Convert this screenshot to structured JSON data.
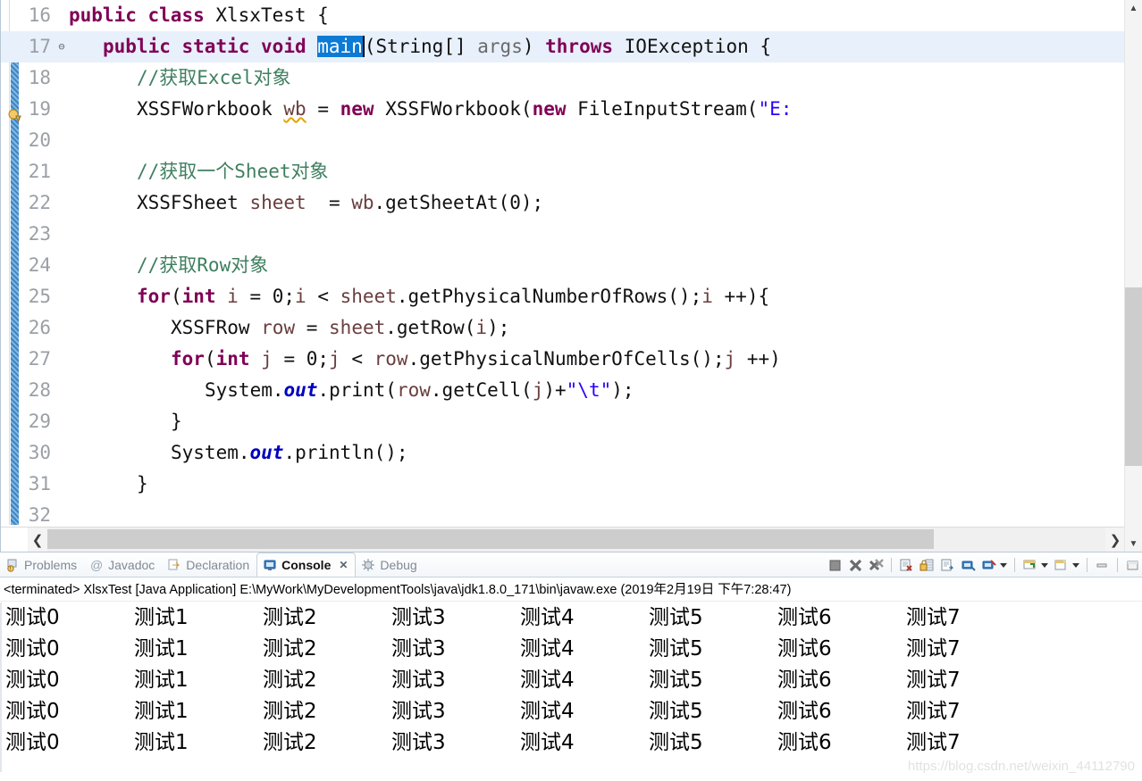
{
  "editor": {
    "first_line": 16,
    "lines": [
      {
        "no": "16",
        "fold": false,
        "warn": false,
        "current": false,
        "indent": 0,
        "tokens": [
          {
            "t": "public ",
            "c": "kw"
          },
          {
            "t": "class ",
            "c": "kw"
          },
          {
            "t": "XlsxTest ",
            "c": "plain"
          },
          {
            "t": "{",
            "c": "plain"
          }
        ]
      },
      {
        "no": "17",
        "fold": true,
        "warn": false,
        "current": true,
        "indent": 1,
        "tokens": [
          {
            "t": "public ",
            "c": "kw"
          },
          {
            "t": "static ",
            "c": "kw"
          },
          {
            "t": "void ",
            "c": "kw"
          },
          {
            "t": "main",
            "c": "sel"
          },
          {
            "t": "(String[] ",
            "c": "plain"
          },
          {
            "t": "args",
            "c": "prm"
          },
          {
            "t": ") ",
            "c": "plain"
          },
          {
            "t": "throws ",
            "c": "kw"
          },
          {
            "t": "IOException {",
            "c": "plain"
          }
        ]
      },
      {
        "no": "18",
        "fold": false,
        "warn": false,
        "current": false,
        "indent": 2,
        "tokens": [
          {
            "t": "//获取Excel对象",
            "c": "cmt"
          }
        ]
      },
      {
        "no": "19",
        "fold": false,
        "warn": true,
        "current": false,
        "indent": 2,
        "tokens": [
          {
            "t": "XSSFWorkbook ",
            "c": "plain"
          },
          {
            "t": "wb",
            "c": "loc warnunder"
          },
          {
            "t": " = ",
            "c": "plain"
          },
          {
            "t": "new ",
            "c": "kw"
          },
          {
            "t": "XSSFWorkbook(",
            "c": "plain"
          },
          {
            "t": "new ",
            "c": "kw"
          },
          {
            "t": "FileInputStream(",
            "c": "plain"
          },
          {
            "t": "\"E:",
            "c": "str"
          }
        ]
      },
      {
        "no": "20",
        "fold": false,
        "warn": false,
        "current": false,
        "indent": 0,
        "tokens": []
      },
      {
        "no": "21",
        "fold": false,
        "warn": false,
        "current": false,
        "indent": 2,
        "tokens": [
          {
            "t": "//获取一个Sheet对象",
            "c": "cmt"
          }
        ]
      },
      {
        "no": "22",
        "fold": false,
        "warn": false,
        "current": false,
        "indent": 2,
        "tokens": [
          {
            "t": "XSSFSheet ",
            "c": "plain"
          },
          {
            "t": "sheet",
            "c": "loc"
          },
          {
            "t": "  = ",
            "c": "plain"
          },
          {
            "t": "wb",
            "c": "loc"
          },
          {
            "t": ".getSheetAt(0);",
            "c": "plain"
          }
        ]
      },
      {
        "no": "23",
        "fold": false,
        "warn": false,
        "current": false,
        "indent": 0,
        "tokens": []
      },
      {
        "no": "24",
        "fold": false,
        "warn": false,
        "current": false,
        "indent": 2,
        "tokens": [
          {
            "t": "//获取Row对象",
            "c": "cmt"
          }
        ]
      },
      {
        "no": "25",
        "fold": false,
        "warn": false,
        "current": false,
        "indent": 2,
        "tokens": [
          {
            "t": "for",
            "c": "kw"
          },
          {
            "t": "(",
            "c": "plain"
          },
          {
            "t": "int ",
            "c": "kw"
          },
          {
            "t": "i",
            "c": "loc"
          },
          {
            "t": " = 0;",
            "c": "plain"
          },
          {
            "t": "i",
            "c": "loc"
          },
          {
            "t": " < ",
            "c": "plain"
          },
          {
            "t": "sheet",
            "c": "loc"
          },
          {
            "t": ".getPhysicalNumberOfRows();",
            "c": "plain"
          },
          {
            "t": "i",
            "c": "loc"
          },
          {
            "t": " ++){",
            "c": "plain"
          }
        ]
      },
      {
        "no": "26",
        "fold": false,
        "warn": false,
        "current": false,
        "indent": 3,
        "tokens": [
          {
            "t": "XSSFRow ",
            "c": "plain"
          },
          {
            "t": "row",
            "c": "loc"
          },
          {
            "t": " = ",
            "c": "plain"
          },
          {
            "t": "sheet",
            "c": "loc"
          },
          {
            "t": ".getRow(",
            "c": "plain"
          },
          {
            "t": "i",
            "c": "loc"
          },
          {
            "t": ");",
            "c": "plain"
          }
        ]
      },
      {
        "no": "27",
        "fold": false,
        "warn": false,
        "current": false,
        "indent": 3,
        "tokens": [
          {
            "t": "for",
            "c": "kw"
          },
          {
            "t": "(",
            "c": "plain"
          },
          {
            "t": "int ",
            "c": "kw"
          },
          {
            "t": "j",
            "c": "loc"
          },
          {
            "t": " = 0;",
            "c": "plain"
          },
          {
            "t": "j",
            "c": "loc"
          },
          {
            "t": " < ",
            "c": "plain"
          },
          {
            "t": "row",
            "c": "loc"
          },
          {
            "t": ".getPhysicalNumberOfCells();",
            "c": "plain"
          },
          {
            "t": "j",
            "c": "loc"
          },
          {
            "t": " ++)",
            "c": "plain"
          }
        ]
      },
      {
        "no": "28",
        "fold": false,
        "warn": false,
        "current": false,
        "indent": 4,
        "tokens": [
          {
            "t": "System.",
            "c": "plain"
          },
          {
            "t": "out",
            "c": "fld"
          },
          {
            "t": ".print(",
            "c": "plain"
          },
          {
            "t": "row",
            "c": "loc"
          },
          {
            "t": ".getCell(",
            "c": "plain"
          },
          {
            "t": "j",
            "c": "loc"
          },
          {
            "t": ")+",
            "c": "plain"
          },
          {
            "t": "\"\\t\"",
            "c": "str"
          },
          {
            "t": ");",
            "c": "plain"
          }
        ]
      },
      {
        "no": "29",
        "fold": false,
        "warn": false,
        "current": false,
        "indent": 3,
        "tokens": [
          {
            "t": "}",
            "c": "plain"
          }
        ]
      },
      {
        "no": "30",
        "fold": false,
        "warn": false,
        "current": false,
        "indent": 3,
        "tokens": [
          {
            "t": "System.",
            "c": "plain"
          },
          {
            "t": "out",
            "c": "fld"
          },
          {
            "t": ".println();",
            "c": "plain"
          }
        ]
      },
      {
        "no": "31",
        "fold": false,
        "warn": false,
        "current": false,
        "indent": 2,
        "tokens": [
          {
            "t": "}",
            "c": "plain"
          }
        ]
      },
      {
        "no": "32",
        "fold": false,
        "warn": false,
        "current": false,
        "indent": 0,
        "tokens": []
      }
    ]
  },
  "panel": {
    "tabs": [
      {
        "label": "Problems",
        "icon": "problems-icon",
        "active": false,
        "closable": false
      },
      {
        "label": "Javadoc",
        "icon": "javadoc-icon",
        "active": false,
        "closable": false
      },
      {
        "label": "Declaration",
        "icon": "declaration-icon",
        "active": false,
        "closable": false
      },
      {
        "label": "Console",
        "icon": "console-icon",
        "active": true,
        "closable": true
      },
      {
        "label": "Debug",
        "icon": "debug-icon",
        "active": false,
        "closable": false
      }
    ],
    "close_glyph": "✕",
    "toolbar_icons": [
      "terminate-icon",
      "remove-launch-icon",
      "remove-all-terminated-icon",
      "clear-console-icon",
      "scroll-lock-icon",
      "word-wrap-icon",
      "show-console-on-output-icon",
      "pin-console-icon",
      "display-selected-console-icon",
      "open-console-icon",
      "minimize-icon",
      "maximize-icon"
    ],
    "terminated_line": "<terminated> XlsxTest [Java Application] E:\\MyWork\\MyDevelopmentTools\\java\\jdk1.8.0_171\\bin\\javaw.exe (2019年2月19日 下午7:28:47)",
    "console_rows": [
      [
        "测试0",
        "测试1",
        "测试2",
        "测试3",
        "测试4",
        "测试5",
        "测试6",
        "测试7"
      ],
      [
        "测试0",
        "测试1",
        "测试2",
        "测试3",
        "测试4",
        "测试5",
        "测试6",
        "测试7"
      ],
      [
        "测试0",
        "测试1",
        "测试2",
        "测试3",
        "测试4",
        "测试5",
        "测试6",
        "测试7"
      ],
      [
        "测试0",
        "测试1",
        "测试2",
        "测试3",
        "测试4",
        "测试5",
        "测试6",
        "测试7"
      ],
      [
        "测试0",
        "测试1",
        "测试2",
        "测试3",
        "测试4",
        "测试5",
        "测试6",
        "测试7"
      ]
    ]
  },
  "watermark": "https://blog.csdn.net/weixin_44112790",
  "colors": {
    "selection": "#0d7ad4",
    "current_line": "#e8f0fb",
    "keyword": "#7f0055",
    "comment": "#3f7f5f",
    "string": "#2a00ff",
    "field": "#0000c0",
    "local_var": "#6a3e3e",
    "changebar": "#2f7fc4",
    "warning_squiggle": "#e0a800"
  }
}
